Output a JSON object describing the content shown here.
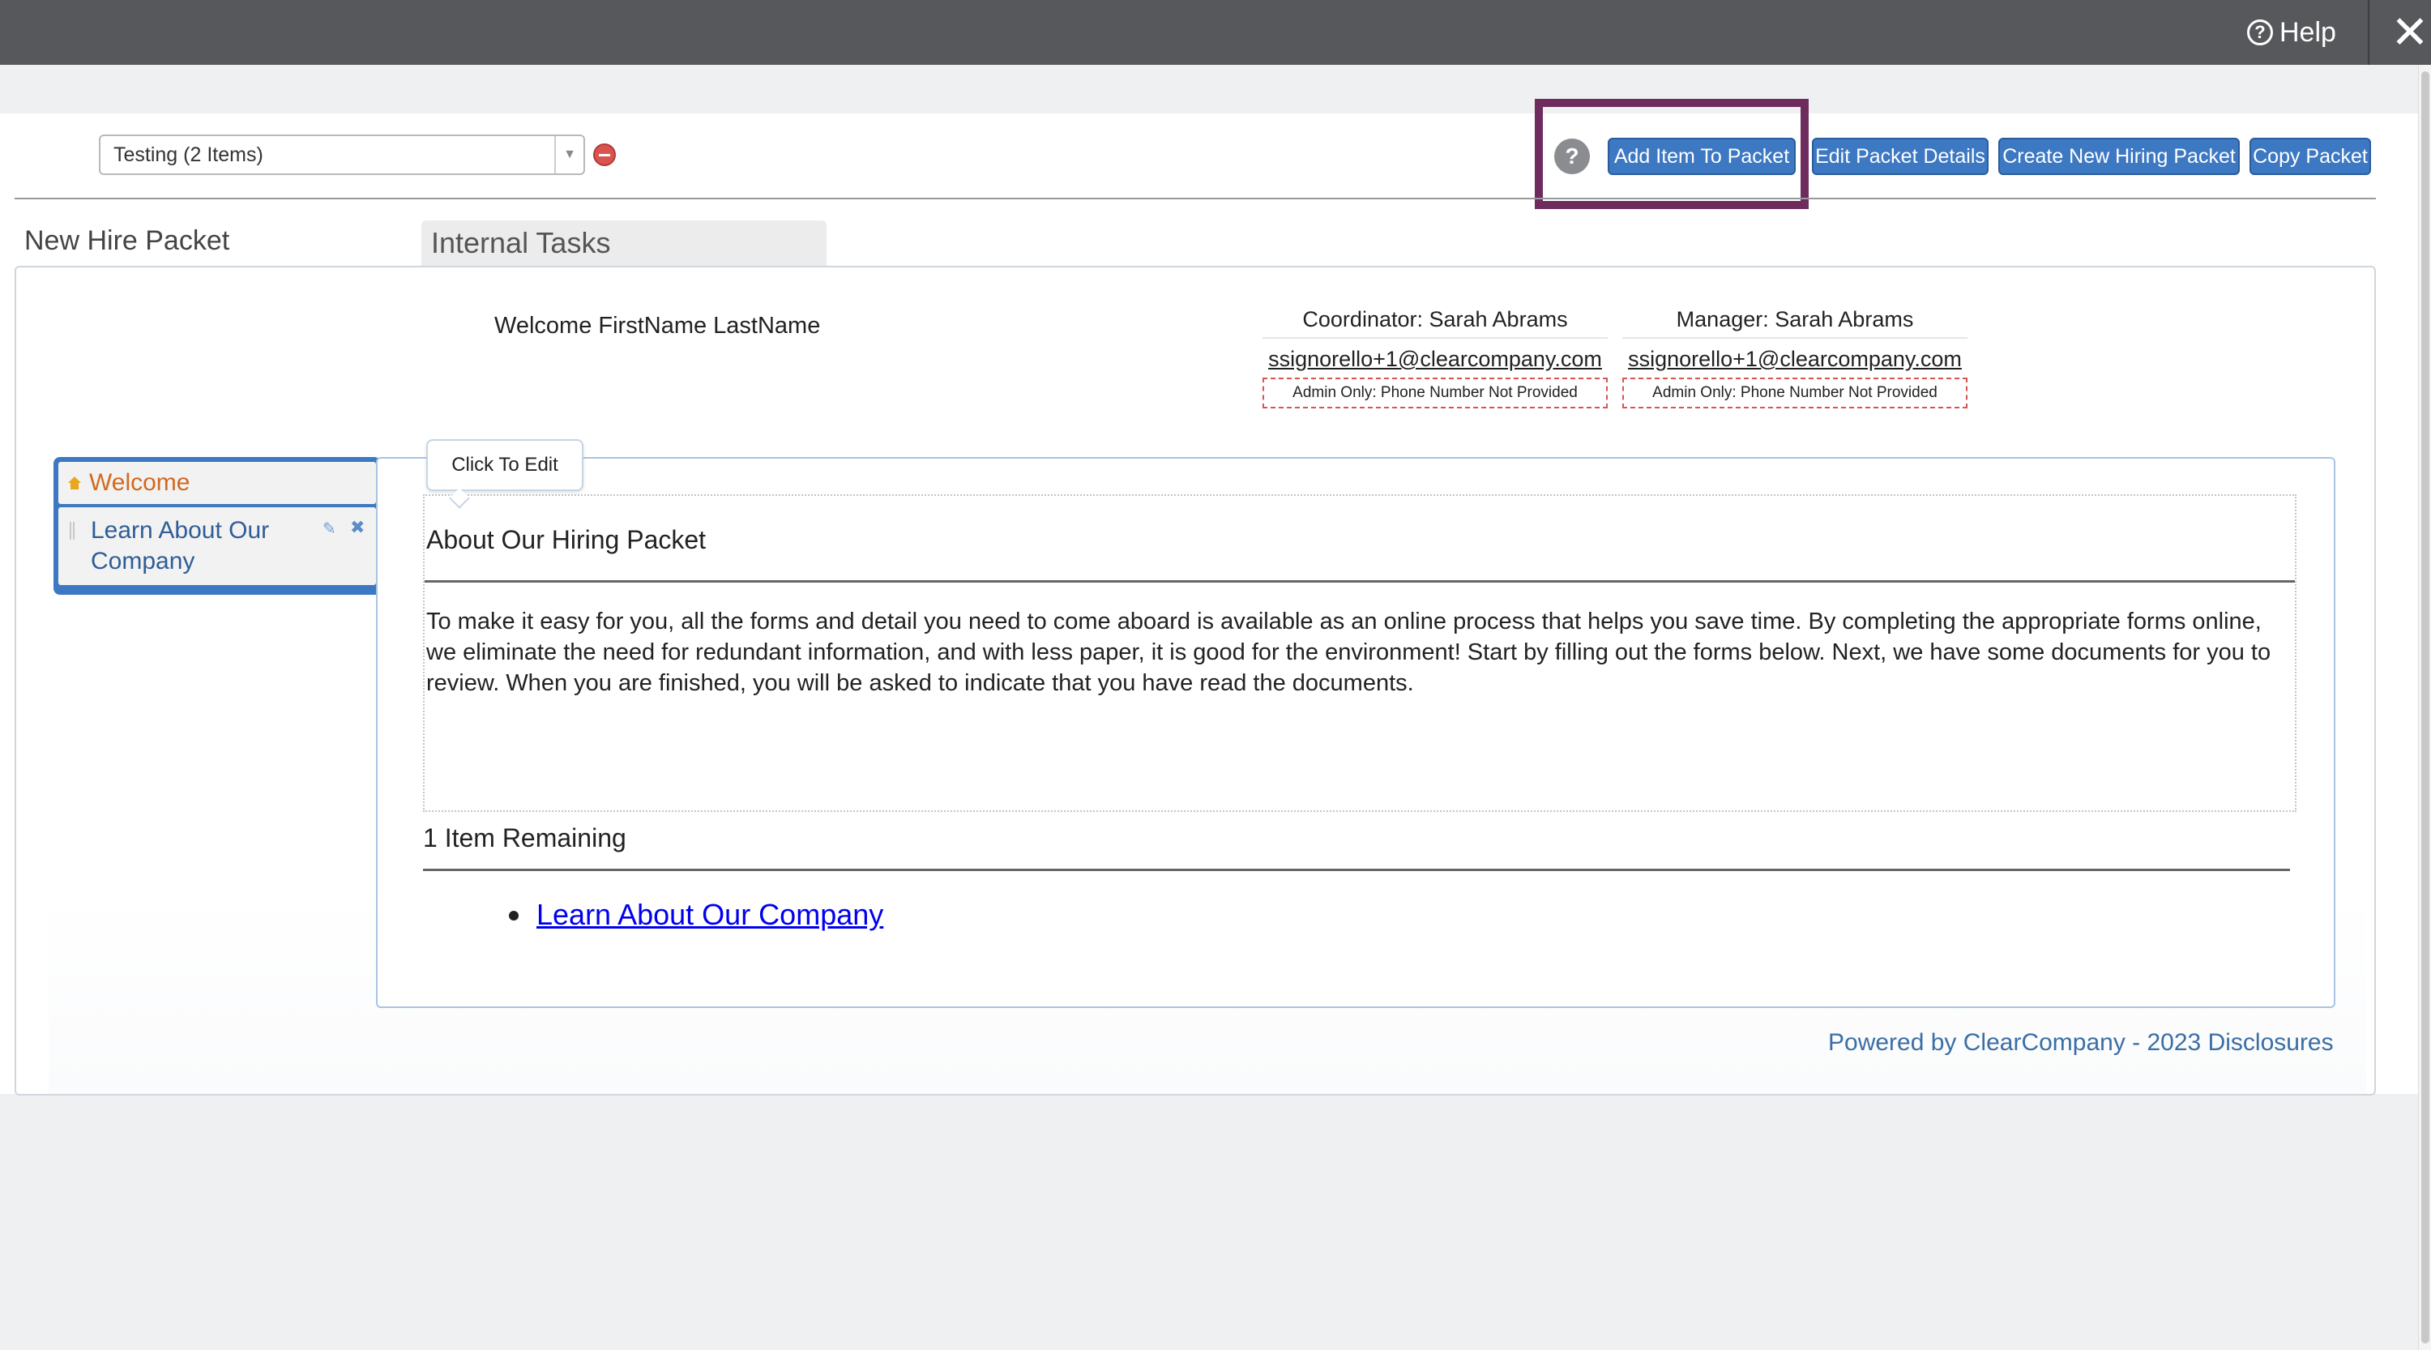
{
  "topbar": {
    "help_label": "Help",
    "help_icon": "question-circle-icon",
    "close_icon": "close-x-icon"
  },
  "toolbar": {
    "packet_select_value": "Testing (2 Items)",
    "help_q": "?",
    "add_item_label": "Add Item To Packet",
    "edit_details_label": "Edit Packet Details",
    "create_packet_label": "Create New Hiring Packet",
    "copy_packet_label": "Copy Packet",
    "accent_color": "#3d78c2",
    "highlight_color": "#6e2c5e"
  },
  "tabs": {
    "new_hire": "New Hire Packet",
    "internal": "Internal Tasks"
  },
  "welcome": {
    "greeting": "Welcome FirstName LastName"
  },
  "contacts": [
    {
      "role": "Coordinator: Sarah Abrams",
      "email": "ssignorello+1@clearcompany.com",
      "phone": "Admin Only: Phone Number Not Provided"
    },
    {
      "role": "Manager: Sarah Abrams",
      "email": "ssignorello+1@clearcompany.com",
      "phone": "Admin Only: Phone Number Not Provided"
    }
  ],
  "sidebar": {
    "items": [
      {
        "label": "Welcome",
        "icon": "home-icon"
      },
      {
        "label": "Learn About Our Company",
        "icons": [
          "drag-handle-icon",
          "pencil-icon",
          "x-icon"
        ]
      }
    ]
  },
  "content": {
    "tooltip": "Click To Edit",
    "title": "About Our Hiring Packet",
    "body": "To make it easy for you, all the forms and detail you need to come aboard is available as an online process that helps you save time. By completing the appropriate forms online, we eliminate the need for redundant information, and with less paper, it is good for the environment! Start by filling out the forms below. Next, we have some documents for you to review. When you are finished, you will be asked to indicate that you have read the documents.",
    "remaining_title": "1 Item Remaining",
    "remaining_items": [
      "Learn About Our Company"
    ]
  },
  "footer": {
    "text": "Powered by ClearCompany - 2023 Disclosures"
  }
}
